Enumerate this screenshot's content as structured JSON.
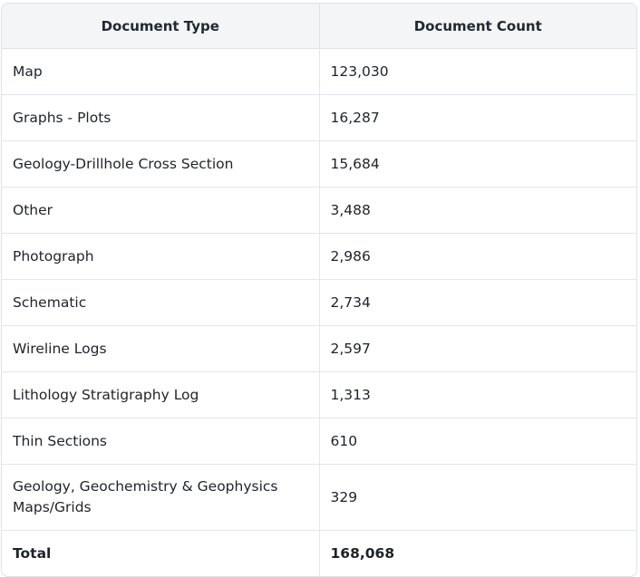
{
  "table": {
    "headers": [
      "Document Type",
      "Document Count"
    ],
    "rows": [
      [
        "Map",
        "123,030"
      ],
      [
        "Graphs - Plots",
        "16,287"
      ],
      [
        "Geology-Drillhole Cross Section",
        "15,684"
      ],
      [
        "Other",
        "3,488"
      ],
      [
        "Photograph",
        "2,986"
      ],
      [
        "Schematic",
        "2,734"
      ],
      [
        "Wireline Logs",
        "2,597"
      ],
      [
        "Lithology Stratigraphy Log",
        "1,313"
      ],
      [
        "Thin Sections",
        "610"
      ],
      [
        "Geology, Geochemistry & Geophysics Maps/Grids",
        "329"
      ]
    ],
    "total": [
      "Total",
      "168,068"
    ]
  }
}
